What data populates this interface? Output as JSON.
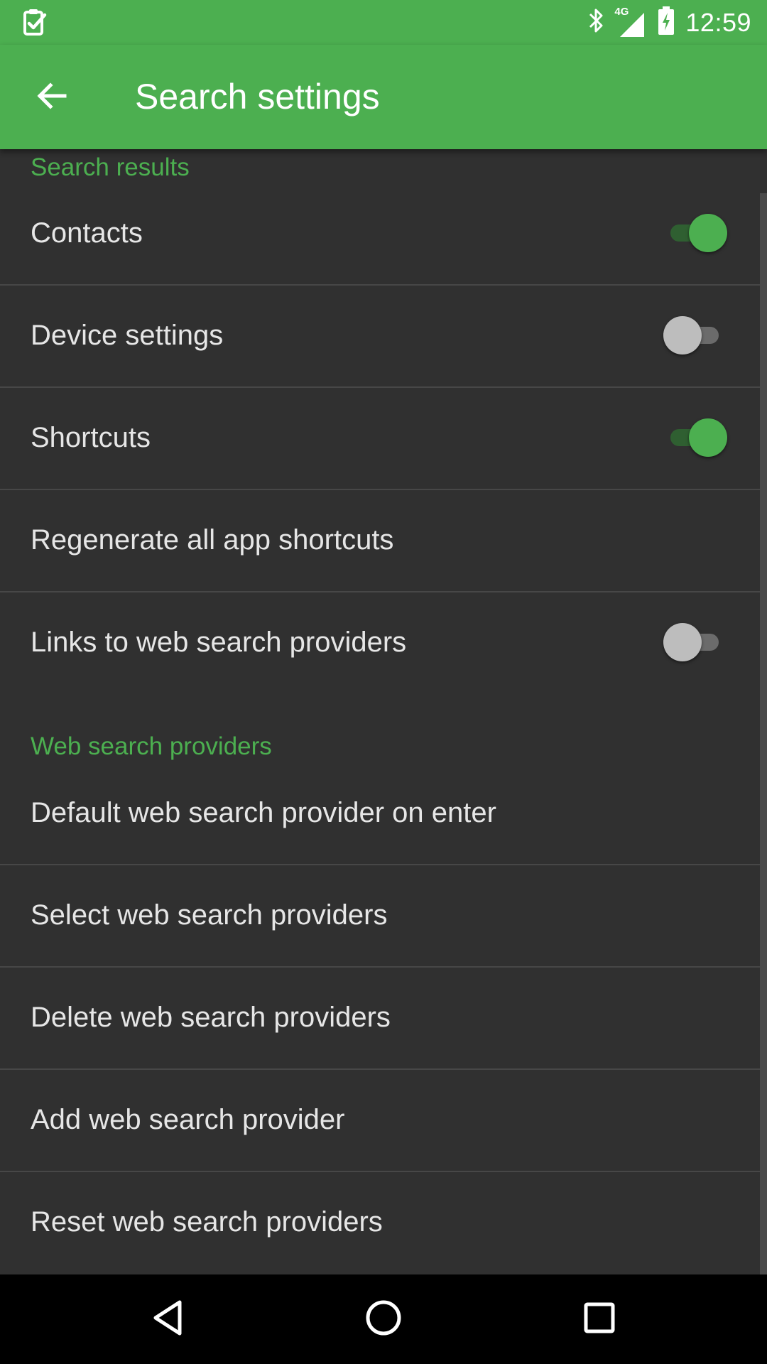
{
  "status_bar": {
    "time": "12:59",
    "network": "4G",
    "icons": [
      "task-check-icon",
      "bluetooth-icon",
      "cellular-signal-icon",
      "battery-charging-icon"
    ]
  },
  "app_bar": {
    "title": "Search settings",
    "back_icon": "arrow-back-icon"
  },
  "sections": {
    "search_results": {
      "title": "Search results",
      "items": {
        "contacts": {
          "label": "Contacts",
          "enabled": true
        },
        "device_settings": {
          "label": "Device settings",
          "enabled": false
        },
        "shortcuts": {
          "label": "Shortcuts",
          "enabled": true
        },
        "regenerate": {
          "label": "Regenerate all app shortcuts"
        },
        "links": {
          "label": "Links to web search providers",
          "enabled": false
        }
      }
    },
    "web_search_providers": {
      "title": "Web search providers",
      "items": {
        "default_provider": {
          "label": "Default web search provider on enter"
        },
        "select_providers": {
          "label": "Select web search providers"
        },
        "delete_providers": {
          "label": "Delete web search providers"
        },
        "add_provider": {
          "label": "Add web search provider"
        },
        "reset_providers": {
          "label": "Reset web search providers"
        }
      }
    }
  },
  "nav_bar": {
    "icons": [
      "back-triangle-icon",
      "home-circle-icon",
      "recents-square-icon"
    ]
  },
  "colors": {
    "accent": "#4caf50",
    "background": "#303030",
    "text": "#e6e6e6",
    "divider": "#474747"
  }
}
